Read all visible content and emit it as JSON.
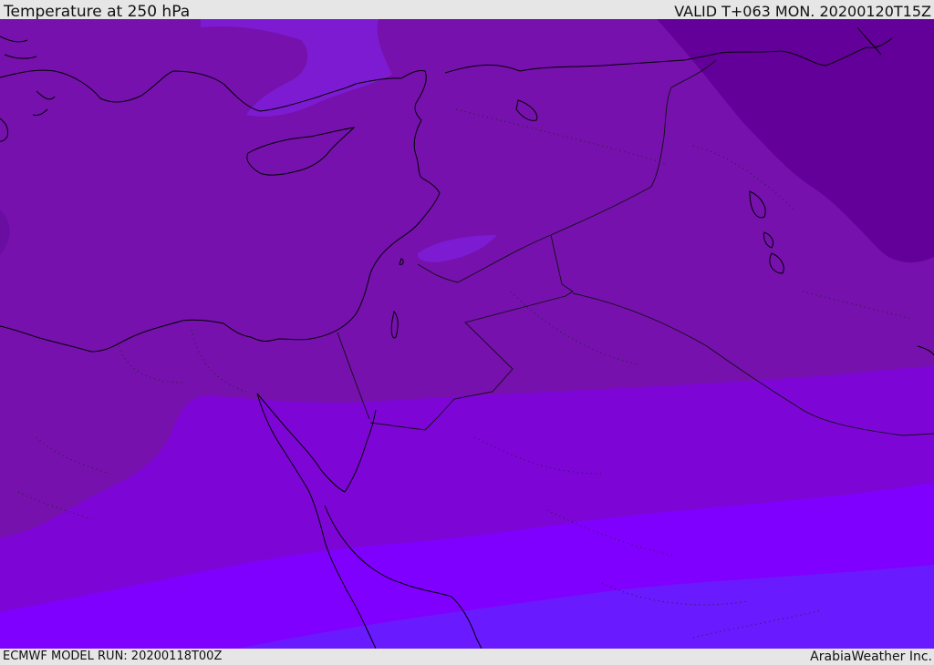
{
  "header": {
    "title": "Temperature at 250 hPa",
    "valid": "VALID T+063 MON. 20200120T15Z"
  },
  "footer": {
    "model_run": "ECMWF MODEL RUN: 20200118T00Z",
    "credit": "ArabiaWeather Inc."
  },
  "map": {
    "field": "temperature",
    "level": "250 hPa",
    "colors": {
      "coldest": "#64009a",
      "very_cold": "#6d10a6",
      "cold": "#7611ad",
      "cool": "#7d06d6",
      "mild": "#8000ff",
      "warmest": "#6a1aff",
      "accent_patch": "#7d1bd2",
      "coastline": "#000000",
      "borders": "#222222"
    }
  }
}
